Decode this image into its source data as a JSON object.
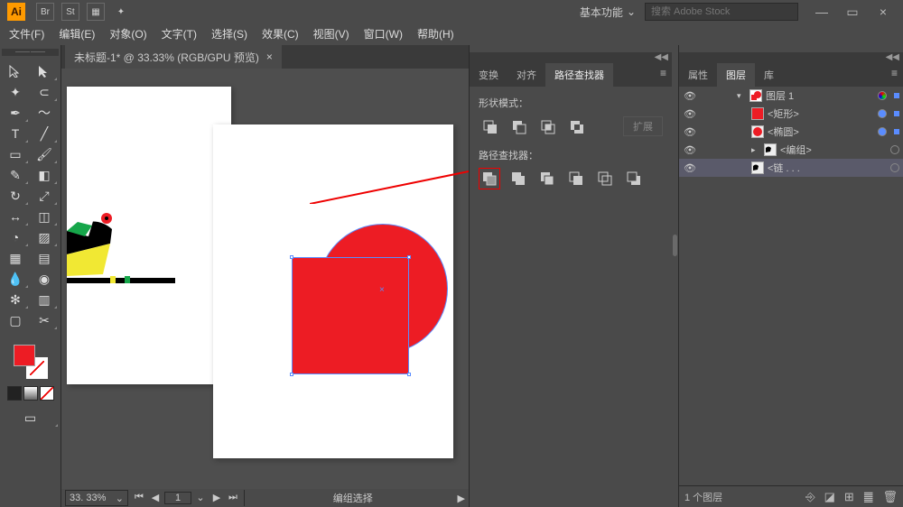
{
  "app": {
    "logo_text": "Ai",
    "workspace_label": "基本功能",
    "search_placeholder": "搜索 Adobe Stock"
  },
  "win": {
    "min": "—",
    "max": "▭",
    "close": "×"
  },
  "menus": [
    "文件(F)",
    "编辑(E)",
    "对象(O)",
    "文字(T)",
    "选择(S)",
    "效果(C)",
    "视图(V)",
    "窗口(W)",
    "帮助(H)"
  ],
  "doc": {
    "tab_title": "未标题-1* @ 33.33% (RGB/GPU 预览)",
    "tab_close": "×"
  },
  "status": {
    "zoom": "33. 33%",
    "nav_page": "1",
    "selection_label": "编组选择"
  },
  "panel_left": {
    "tabs": [
      "变换",
      "对齐",
      "路径查找器"
    ],
    "shape_mode_label": "形状模式：",
    "expand_label": "扩展",
    "pathfinder_label": "路径查找器："
  },
  "panel_right": {
    "tabs": [
      "属性",
      "图层",
      "库"
    ],
    "layer_root": "图层 1",
    "items": [
      "<矩形>",
      "<椭圆>",
      "<编组>",
      "<链 . . ."
    ],
    "footer_count": "1 个图层",
    "footer_label": "个图层"
  },
  "colors": {
    "primary": "#ed1c24",
    "highlight": "#e00"
  }
}
